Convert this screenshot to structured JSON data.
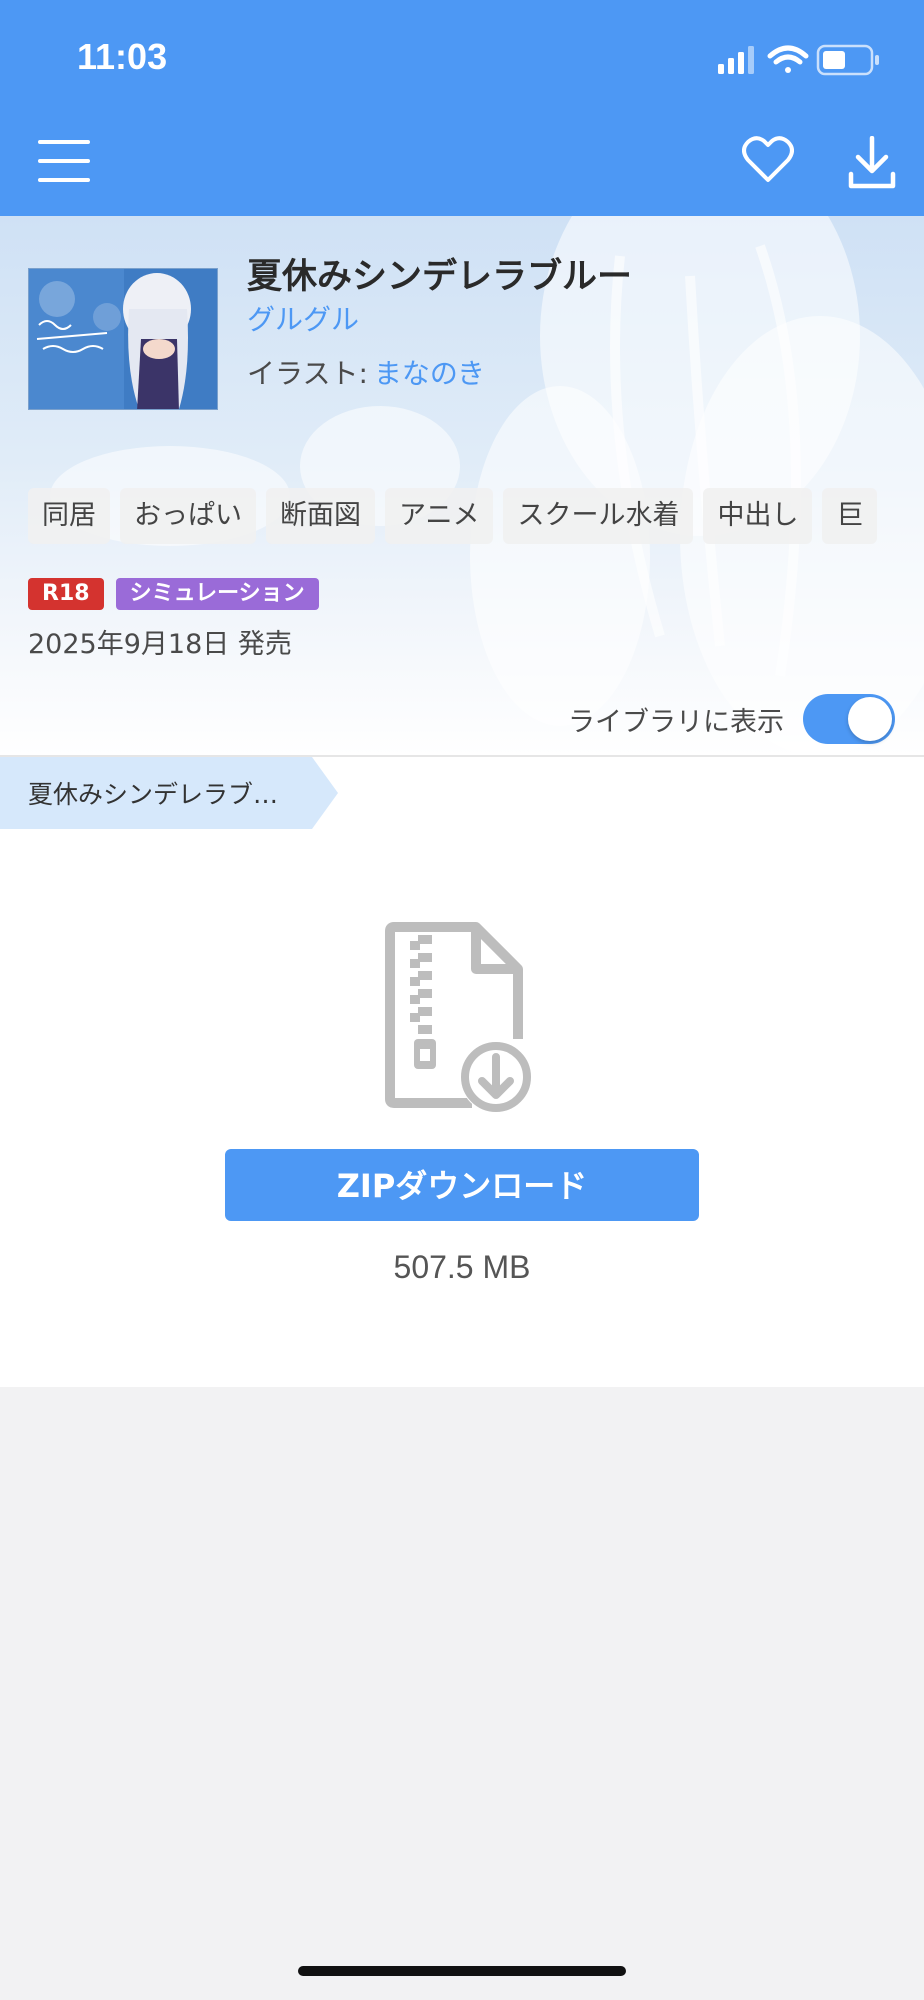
{
  "status_bar": {
    "time": "11:03",
    "icons": [
      "signal-icon",
      "wifi-icon",
      "battery-icon"
    ]
  },
  "header": {
    "icons": [
      "menu-icon",
      "heart-icon",
      "download-icon"
    ]
  },
  "work": {
    "title": "夏休みシンデレラブルー",
    "circle": "グルグル",
    "illustrator_label": "イラスト:",
    "illustrator": "まなのき",
    "tags": [
      "同居",
      "おっぱい",
      "断面図",
      "アニメ",
      "スクール水着",
      "中出し",
      "巨"
    ],
    "badges": {
      "rating": "R18",
      "genre": "シミュレーション"
    },
    "release_date": "2025年9月18日 発売"
  },
  "library": {
    "label": "ライブラリに表示",
    "enabled": true
  },
  "breadcrumb": {
    "label": "夏休みシンデレラブ…"
  },
  "download": {
    "button_label": "ZIPダウンロード",
    "size": "507.5 MB"
  },
  "colors": {
    "accent": "#4d98f4",
    "r18": "#d4332f",
    "genre": "#9a6bd8"
  }
}
